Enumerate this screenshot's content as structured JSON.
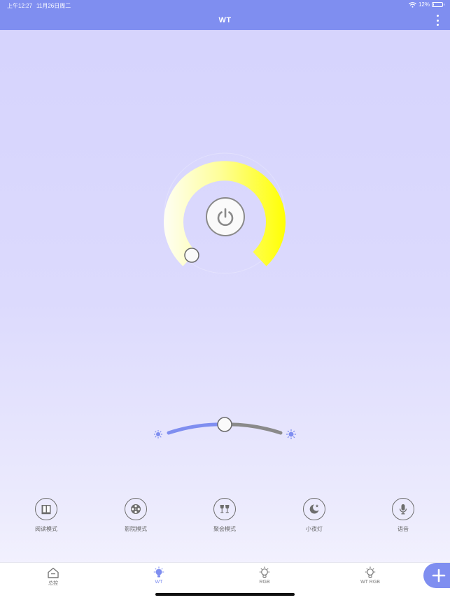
{
  "status_bar": {
    "time": "上午12:27",
    "date": "11月26日周二",
    "battery": "12%",
    "battery_level": 0.12,
    "wifi_icon": "wifi-icon"
  },
  "header": {
    "title": "WT",
    "menu_icon": "more-vertical-icon"
  },
  "color_temperature_dial": {
    "power_icon": "power-icon",
    "colors": {
      "warm_white": "#fefef4",
      "yellow": "#ffff00"
    }
  },
  "brightness_slider": {
    "level": 0.5,
    "min_icon": "sun-small-icon",
    "max_icon": "sun-large-icon",
    "active_color": "#7f8ef0",
    "inactive_color": "#8a8a8a"
  },
  "modes": [
    {
      "label": "阅读模式",
      "icon": "book-icon"
    },
    {
      "label": "影院模式",
      "icon": "film-reel-icon"
    },
    {
      "label": "聚会模式",
      "icon": "wine-glasses-icon"
    },
    {
      "label": "小夜灯",
      "icon": "moon-star-icon"
    },
    {
      "label": "语音",
      "icon": "microphone-icon"
    }
  ],
  "tabs": [
    {
      "label": "总控",
      "icon": "home-icon",
      "active": false
    },
    {
      "label": "WT",
      "icon": "bulb-icon",
      "active": true
    },
    {
      "label": "RGB",
      "icon": "bulb-icon",
      "active": false
    },
    {
      "label": "WT RGB",
      "icon": "bulb-icon",
      "active": false
    }
  ],
  "fab": {
    "icon": "plus-icon"
  },
  "colors": {
    "header": "#7f8ef0",
    "accent": "#7f8ef0",
    "background": "#d5d3fd"
  }
}
